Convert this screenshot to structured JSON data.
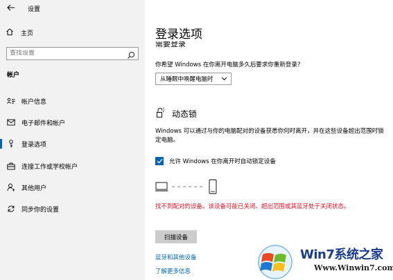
{
  "window": {
    "title": "设置"
  },
  "sidebar": {
    "home_label": "主页",
    "search_placeholder": "查找设置",
    "section_label": "帐户",
    "items": [
      {
        "label": "帐户信息",
        "icon": "account-info-icon"
      },
      {
        "label": "电子邮件和帐户",
        "icon": "mail-icon"
      },
      {
        "label": "登录选项",
        "icon": "key-icon",
        "active": true
      },
      {
        "label": "连接工作或学校帐户",
        "icon": "briefcase-icon"
      },
      {
        "label": "其他用户",
        "icon": "person-add-icon"
      },
      {
        "label": "同步你的设置",
        "icon": "sync-icon"
      }
    ]
  },
  "main": {
    "title": "登录选项",
    "cut_heading": "需要登录",
    "question": "你希望 Windows 在你离开电脑多久后要求你重新登录?",
    "dropdown_value": "从睡眠中唤醒电脑时",
    "dynamic_lock": {
      "heading": "动态锁",
      "description": "Windows 可以通过与你的电脑配对的设备获悉你何时离开，并在这些设备超出范围时锁定电脑。",
      "checkbox_label": "允许 Windows 在你离开时自动锁定设备",
      "checkbox_checked": true,
      "error": "找不到配对的设备。该设备可能已关闭、超出范围或其蓝牙处于关闭状态。",
      "scan_button": "扫描设备"
    },
    "links": [
      "蓝牙和其他设备",
      "了解更多信息"
    ]
  },
  "watermark": {
    "brand": "Win7系统之家",
    "url": "Www.Winwin7.com"
  },
  "colors": {
    "accent": "#0063b1",
    "link": "#0067b8",
    "error": "#e81123",
    "sidebar_bg": "#f2f2f2"
  }
}
